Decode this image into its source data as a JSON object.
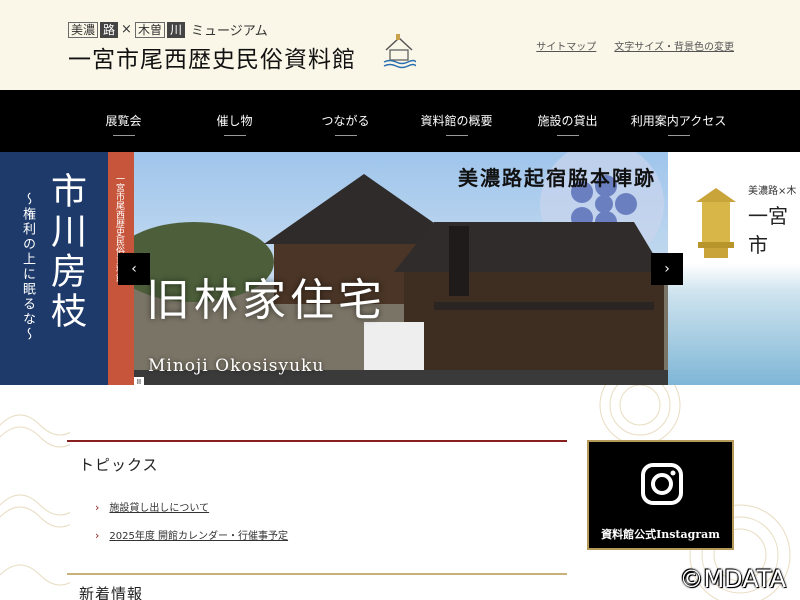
{
  "header": {
    "logo_small": {
      "part1": "美濃",
      "part2": "路",
      "sep1": "×",
      "part3": "木曽",
      "part4": "川",
      "suffix": "ミュージアム"
    },
    "logo_main": "一宮市尾西歴史民俗資料館",
    "links": [
      "サイトマップ",
      "文字サイズ・背景色の変更"
    ]
  },
  "nav": {
    "items": [
      "展覧会",
      "催し物",
      "つながる",
      "資料館の概要",
      "施設の貸出",
      "利用案内アクセス"
    ]
  },
  "hero": {
    "left": {
      "title": "市川房枝",
      "subtitle": "〜権利の上に眠るな〜",
      "stripe": "一宮市尾西歴史民俗資料館"
    },
    "main": {
      "caption_top": "美濃路起宿脇本陣跡",
      "caption_jp": "旧林家住宅",
      "caption_en": "Minoji Okosisyuku"
    },
    "right": {
      "small": "美濃路×木",
      "big": "一宮市"
    },
    "prev": "‹",
    "next": "›",
    "pause": "II"
  },
  "topics": {
    "title": "トピックス",
    "chevron": "›",
    "items": [
      "施設貸し出しについて",
      "2025年度 開館カレンダー・行催事予定"
    ]
  },
  "news": {
    "title": "新着情報"
  },
  "instagram": {
    "label": "資料館公式Instagram"
  },
  "watermark": "©MDATA",
  "colors": {
    "nav_bg": "#000000",
    "header_bg": "#fbf7e8",
    "accent_red": "#8a1f1f",
    "accent_gold": "#c9b27a"
  }
}
